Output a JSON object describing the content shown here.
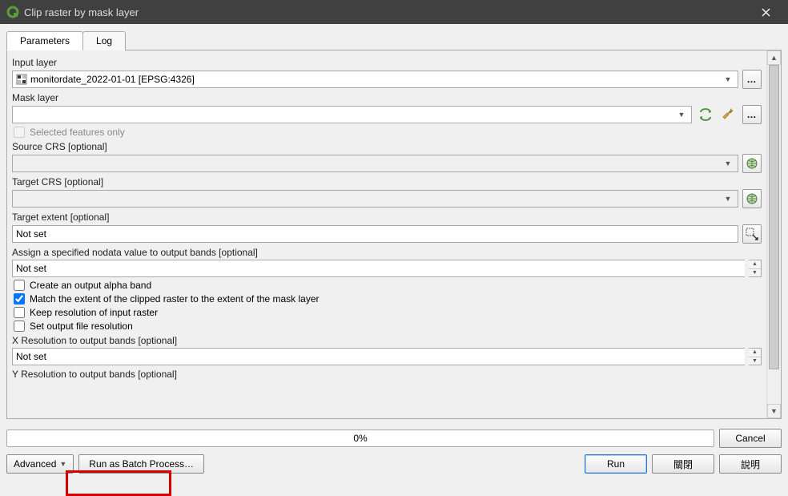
{
  "window": {
    "title": "Clip raster by mask layer"
  },
  "tabs": {
    "parameters": "Parameters",
    "log": "Log"
  },
  "labels": {
    "input_layer": "Input layer",
    "mask_layer": "Mask layer",
    "selected_features_only": "Selected features only",
    "source_crs": "Source CRS [optional]",
    "target_crs": "Target CRS [optional]",
    "target_extent": "Target extent [optional]",
    "assign_nodata": "Assign a specified nodata value to output bands [optional]",
    "create_alpha": "Create an output alpha band",
    "match_extent": "Match the extent of the clipped raster to the extent of the mask layer",
    "keep_resolution": "Keep resolution of input raster",
    "set_output_res": "Set output file resolution",
    "x_resolution": "X Resolution to output bands [optional]",
    "y_resolution": "Y Resolution to output bands [optional]"
  },
  "values": {
    "input_layer": "monitordate_2022-01-01 [EPSG:4326]",
    "mask_layer": "",
    "source_crs": "",
    "target_crs": "",
    "target_extent": "Not set",
    "assign_nodata": "Not set",
    "x_resolution": "Not set",
    "progress": "0%"
  },
  "checkboxes": {
    "selected_features_only": false,
    "create_alpha": false,
    "match_extent": true,
    "keep_resolution": false,
    "set_output_res": false
  },
  "buttons": {
    "cancel": "Cancel",
    "advanced": "Advanced",
    "batch": "Run as Batch Process…",
    "run": "Run",
    "close": "關閉",
    "help": "說明"
  }
}
